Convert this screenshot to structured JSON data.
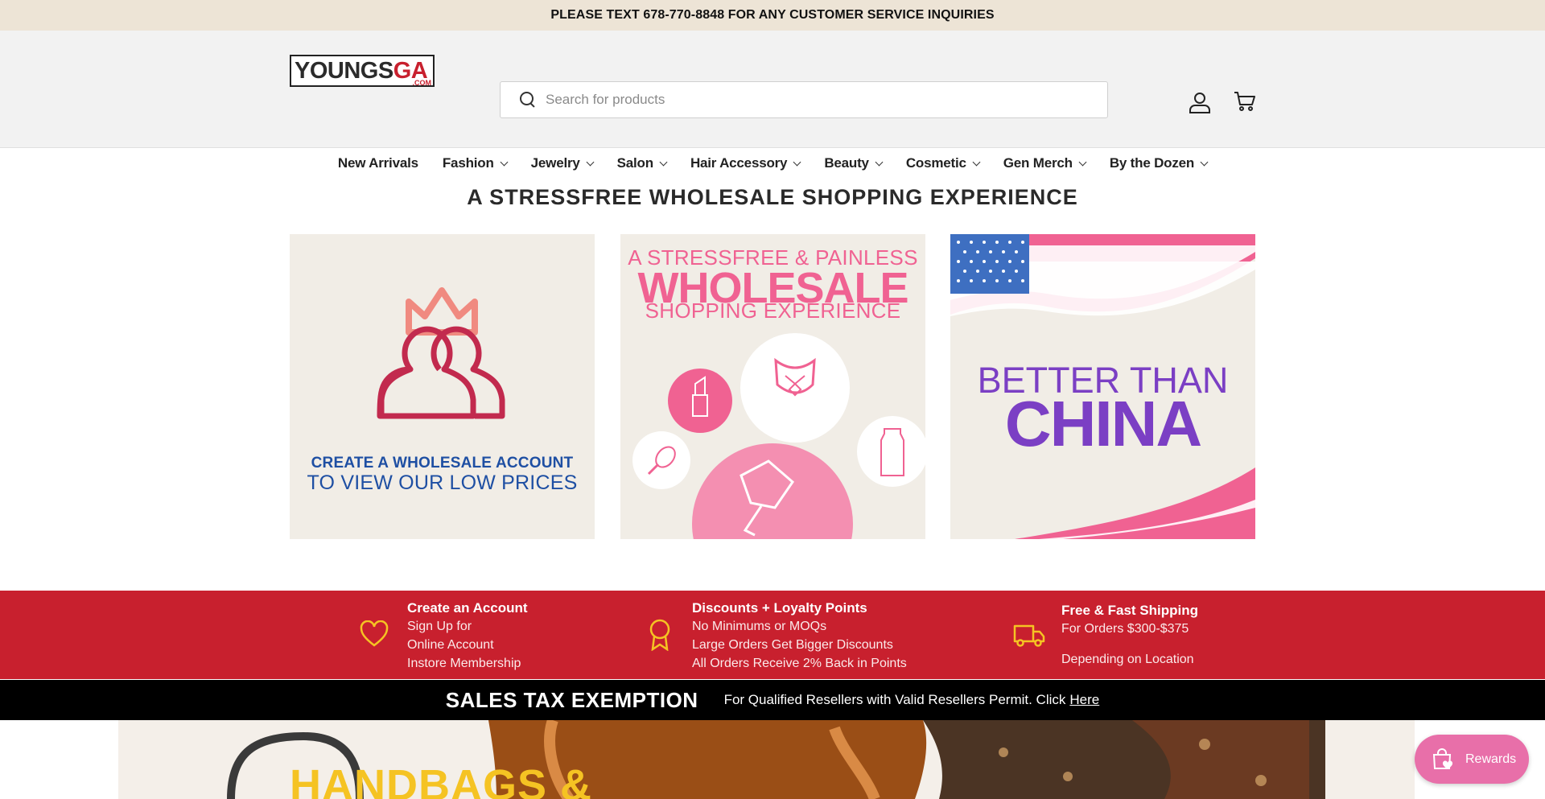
{
  "announcement": "PLEASE TEXT 678-770-8848 FOR ANY CUSTOMER SERVICE INQUIRIES",
  "logo": {
    "dark": "YOUNGS",
    "red": "GA",
    "suffix": ".COM"
  },
  "search": {
    "placeholder": "Search for products"
  },
  "nav": [
    {
      "label": "New Arrivals"
    },
    {
      "label": "Fashion"
    },
    {
      "label": "Jewelry"
    },
    {
      "label": "Salon"
    },
    {
      "label": "Hair Accessory"
    },
    {
      "label": "Beauty"
    },
    {
      "label": "Cosmetic"
    },
    {
      "label": "Gen Merch"
    },
    {
      "label": "By the Dozen"
    }
  ],
  "hero": {
    "title": "A STRESSFREE WHOLESALE SHOPPING EXPERIENCE",
    "tile1": {
      "line1": "CREATE A WHOLESALE ACCOUNT",
      "line2": "TO VIEW OUR LOW PRICES"
    },
    "tile2": {
      "line1": "A STRESSFREE & PAINLESS",
      "line2": "WHOLESALE",
      "line3": "SHOPPING EXPERIENCE"
    },
    "tile3": {
      "line1": "BETTER THAN",
      "line2": "CHINA"
    }
  },
  "perks": [
    {
      "title": "Create an Account",
      "lines": [
        "Sign Up for",
        "Online Account",
        "Instore Membership"
      ],
      "icon": "heart-icon"
    },
    {
      "title": "Discounts + Loyalty Points",
      "lines": [
        "No Minimums or MOQs",
        "Large Orders Get Bigger Discounts",
        "All Orders Receive 2% Back in Points"
      ],
      "icon": "award-ribbon-icon"
    },
    {
      "title": "Free & Fast Shipping",
      "lines": [
        "For Orders $300-$375",
        "Depending on Location"
      ],
      "icon": "truck-icon"
    }
  ],
  "tax": {
    "title": "SALES TAX EXEMPTION",
    "text": "For Qualified Resellers with Valid Resellers Permit. Click",
    "link": "Here"
  },
  "banner": {
    "title": "HANDBAGS &"
  },
  "rewards": {
    "label": "Rewards"
  },
  "colors": {
    "brand_red": "#c8202e",
    "pink": "#f06292",
    "purple": "#7b3fc4",
    "navy": "#1e4fa3",
    "rewards_pink": "#e86fa9",
    "announcement_bg": "#ede4d6"
  }
}
